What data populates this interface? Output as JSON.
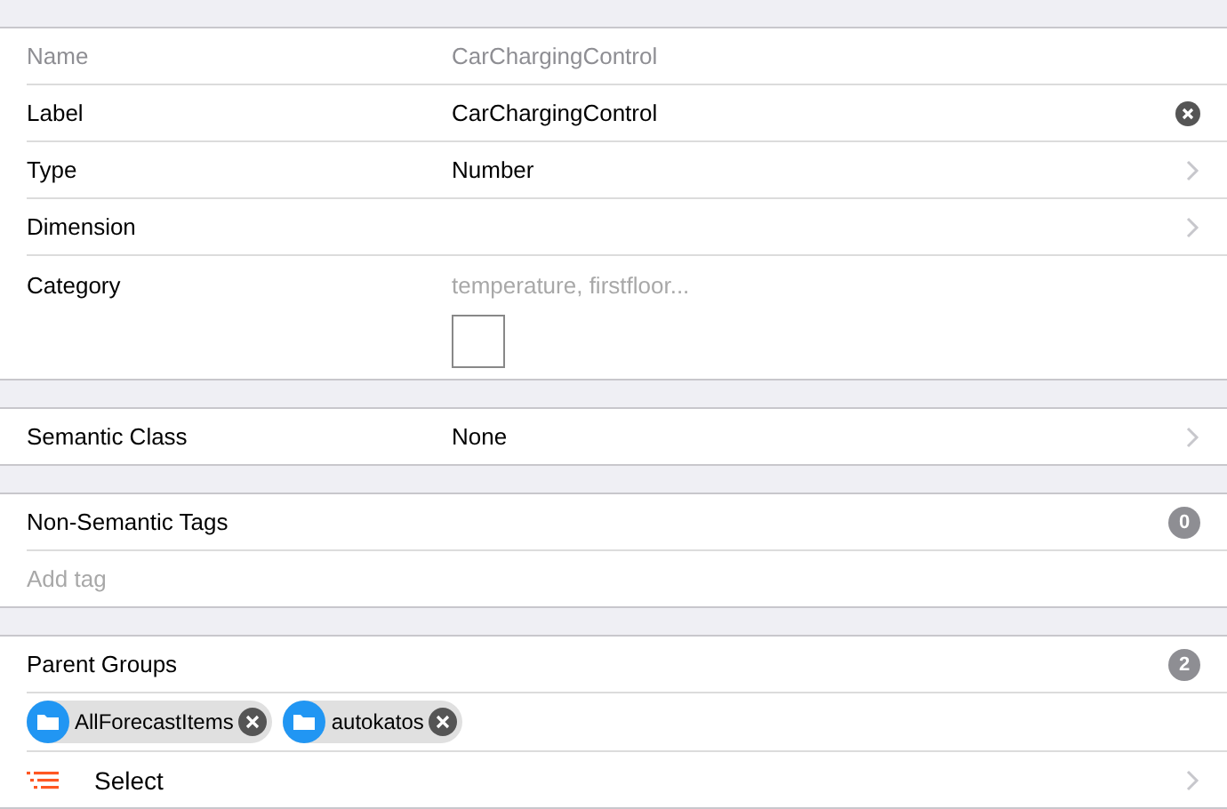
{
  "sections": [
    {
      "rows": [
        {
          "kind": "readonly",
          "label": "Name",
          "value": "CarChargingControl"
        },
        {
          "kind": "input",
          "label": "Label",
          "value": "CarChargingControl"
        },
        {
          "kind": "link",
          "label": "Type",
          "value": "Number"
        },
        {
          "kind": "link",
          "label": "Dimension"
        },
        {
          "kind": "category",
          "label": "Category",
          "placeholder": "temperature, firstfloor..."
        }
      ]
    },
    {
      "rows": [
        {
          "kind": "link",
          "label": "Semantic Class",
          "value": "None"
        }
      ]
    },
    {
      "rows": [
        {
          "kind": "header",
          "label": "Non-Semantic Tags",
          "count": "0"
        },
        {
          "kind": "addtag",
          "placeholder": "Add tag"
        }
      ]
    },
    {
      "rows": [
        {
          "kind": "header",
          "label": "Parent Groups",
          "count": "2"
        },
        {
          "kind": "chips",
          "chips": [
            "AllForecastItems",
            "autokatos"
          ]
        },
        {
          "kind": "select",
          "label": "Select"
        }
      ]
    }
  ]
}
